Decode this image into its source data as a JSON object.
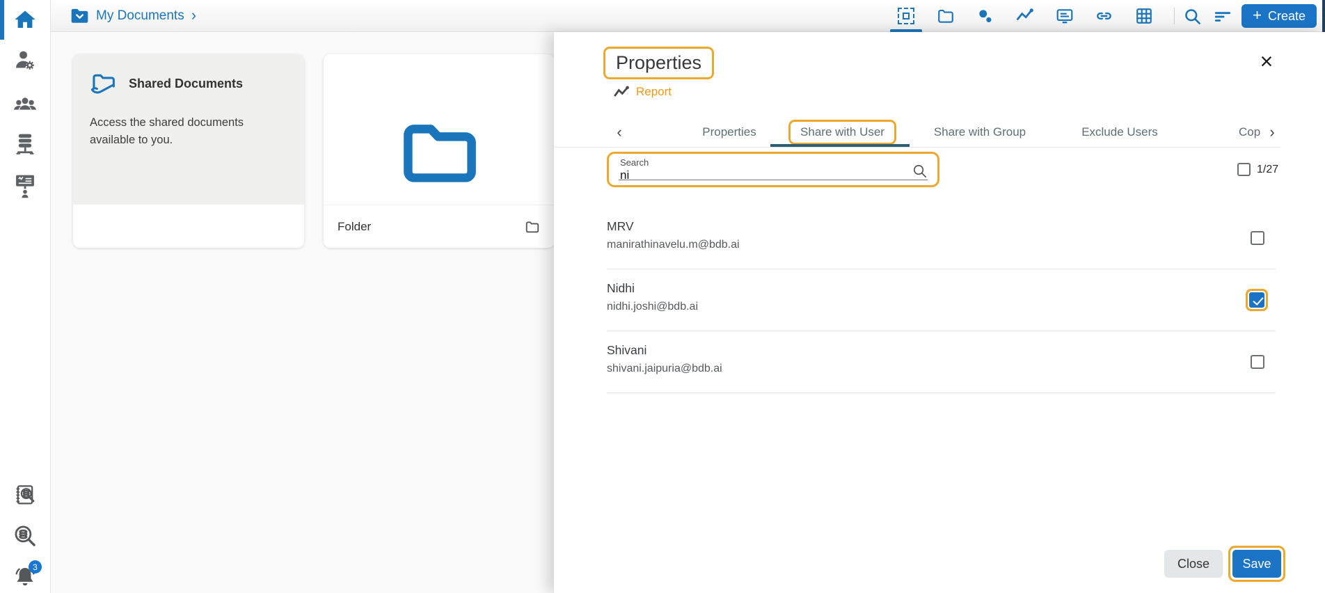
{
  "topbar": {
    "breadcrumb": {
      "label": "My Documents",
      "chevron": "›"
    },
    "create_button": {
      "label": "Create",
      "plus": "+"
    }
  },
  "sidebar": {
    "notification_badge": "3"
  },
  "main": {
    "shared_card": {
      "title": "Shared Documents",
      "description": "Access the shared documents available to you."
    },
    "folder_card": {
      "label": "Folder"
    }
  },
  "panel": {
    "title": "Properties",
    "item_type_label": "Report",
    "close_glyph": "×",
    "tabs": [
      {
        "label": "Properties",
        "active": false
      },
      {
        "label": "Share with User",
        "active": true
      },
      {
        "label": "Share with Group",
        "active": false
      },
      {
        "label": "Exclude Users",
        "active": false
      },
      {
        "label": "Cop",
        "active": false
      }
    ],
    "tab_scroll": {
      "left": "‹",
      "right": "›"
    },
    "search": {
      "label": "Search",
      "value": "ni"
    },
    "selection": {
      "count": "1/27",
      "checked": false
    },
    "users": [
      {
        "name": "MRV",
        "email": "manirathinavelu.m@bdb.ai",
        "checked": false
      },
      {
        "name": "Nidhi",
        "email": "nidhi.joshi@bdb.ai",
        "checked": true
      },
      {
        "name": "Shivani",
        "email": "shivani.jaipuria@bdb.ai",
        "checked": false
      }
    ],
    "footer": {
      "close_label": "Close",
      "save_label": "Save"
    }
  },
  "colors": {
    "primary_blue": "#1b75bb",
    "button_blue": "#1b74c5",
    "accent_orange": "#eba92e",
    "link_orange": "#f39913",
    "tab_underline_teal": "#2b5e72",
    "badge_blue": "#1976d2",
    "sidebar_icon_gray": "#5d6165"
  }
}
